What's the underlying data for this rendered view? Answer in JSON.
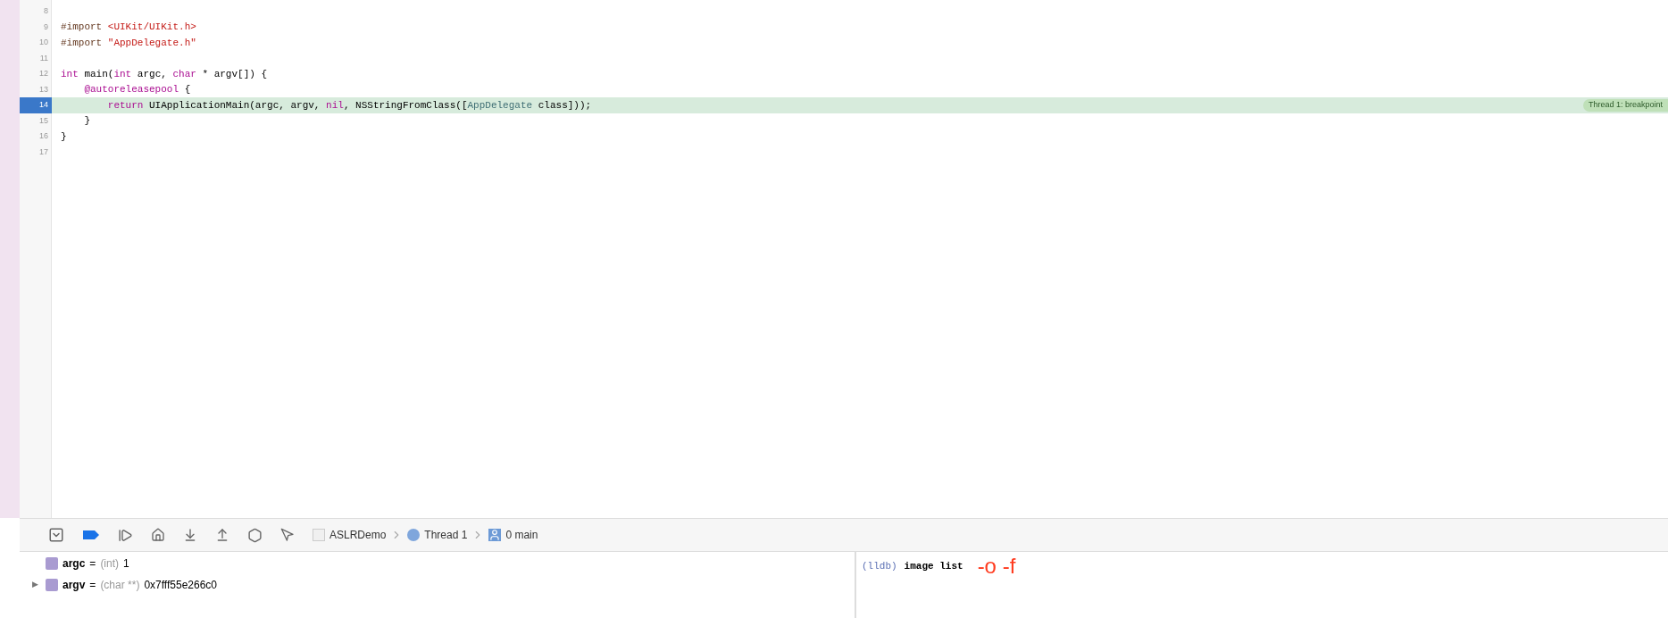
{
  "editor": {
    "lines": [
      {
        "number": "8",
        "current": false
      },
      {
        "number": "9",
        "current": false,
        "tokens": [
          {
            "kind": "preprocessor",
            "text": "#import "
          },
          {
            "kind": "string",
            "text": "<UIKit/UIKit.h>"
          }
        ]
      },
      {
        "number": "10",
        "current": false,
        "tokens": [
          {
            "kind": "preprocessor",
            "text": "#import "
          },
          {
            "kind": "string",
            "text": "\"AppDelegate.h\""
          }
        ]
      },
      {
        "number": "11",
        "current": false
      },
      {
        "number": "12",
        "current": false,
        "tokens": [
          {
            "kind": "keyword",
            "text": "int"
          },
          {
            "kind": "plain",
            "text": " main("
          },
          {
            "kind": "keyword",
            "text": "int"
          },
          {
            "kind": "plain",
            "text": " argc, "
          },
          {
            "kind": "keyword",
            "text": "char"
          },
          {
            "kind": "plain",
            "text": " * argv[]) {"
          }
        ]
      },
      {
        "number": "13",
        "current": false,
        "tokens": [
          {
            "kind": "keyword",
            "text": "    @autoreleasepool"
          },
          {
            "kind": "plain",
            "text": " {"
          }
        ]
      },
      {
        "number": "14",
        "current": true,
        "tokens": [
          {
            "kind": "keyword",
            "text": "        return"
          },
          {
            "kind": "plain",
            "text": " UIApplicationMain(argc, argv, "
          },
          {
            "kind": "keyword",
            "text": "nil"
          },
          {
            "kind": "plain",
            "text": ", NSStringFromClass(["
          },
          {
            "kind": "class",
            "text": "AppDelegate"
          },
          {
            "kind": "plain",
            "text": " class]));"
          }
        ],
        "badge": "Thread 1: breakpoint"
      },
      {
        "number": "15",
        "current": false,
        "tokens": [
          {
            "kind": "plain",
            "text": "    }"
          }
        ]
      },
      {
        "number": "16",
        "current": false,
        "tokens": [
          {
            "kind": "plain",
            "text": "}"
          }
        ]
      },
      {
        "number": "17",
        "current": false
      }
    ]
  },
  "debug_bar": {
    "breakpoints_active": true,
    "breadcrumb": [
      {
        "kind": "app",
        "label": "ASLRDemo"
      },
      {
        "kind": "thread",
        "label": "Thread 1"
      },
      {
        "kind": "frame",
        "label": "0 main"
      }
    ]
  },
  "variables": [
    {
      "name": "argc",
      "separator": "=",
      "type": "(int)",
      "value": "1"
    },
    {
      "disclosure": "▶",
      "name": "argv",
      "separator": "=",
      "type": "(char **)",
      "value": "0x7fff55e266c0"
    }
  ],
  "console": {
    "prompt": "(lldb)",
    "command": "image list",
    "annotation": "-o -f"
  }
}
